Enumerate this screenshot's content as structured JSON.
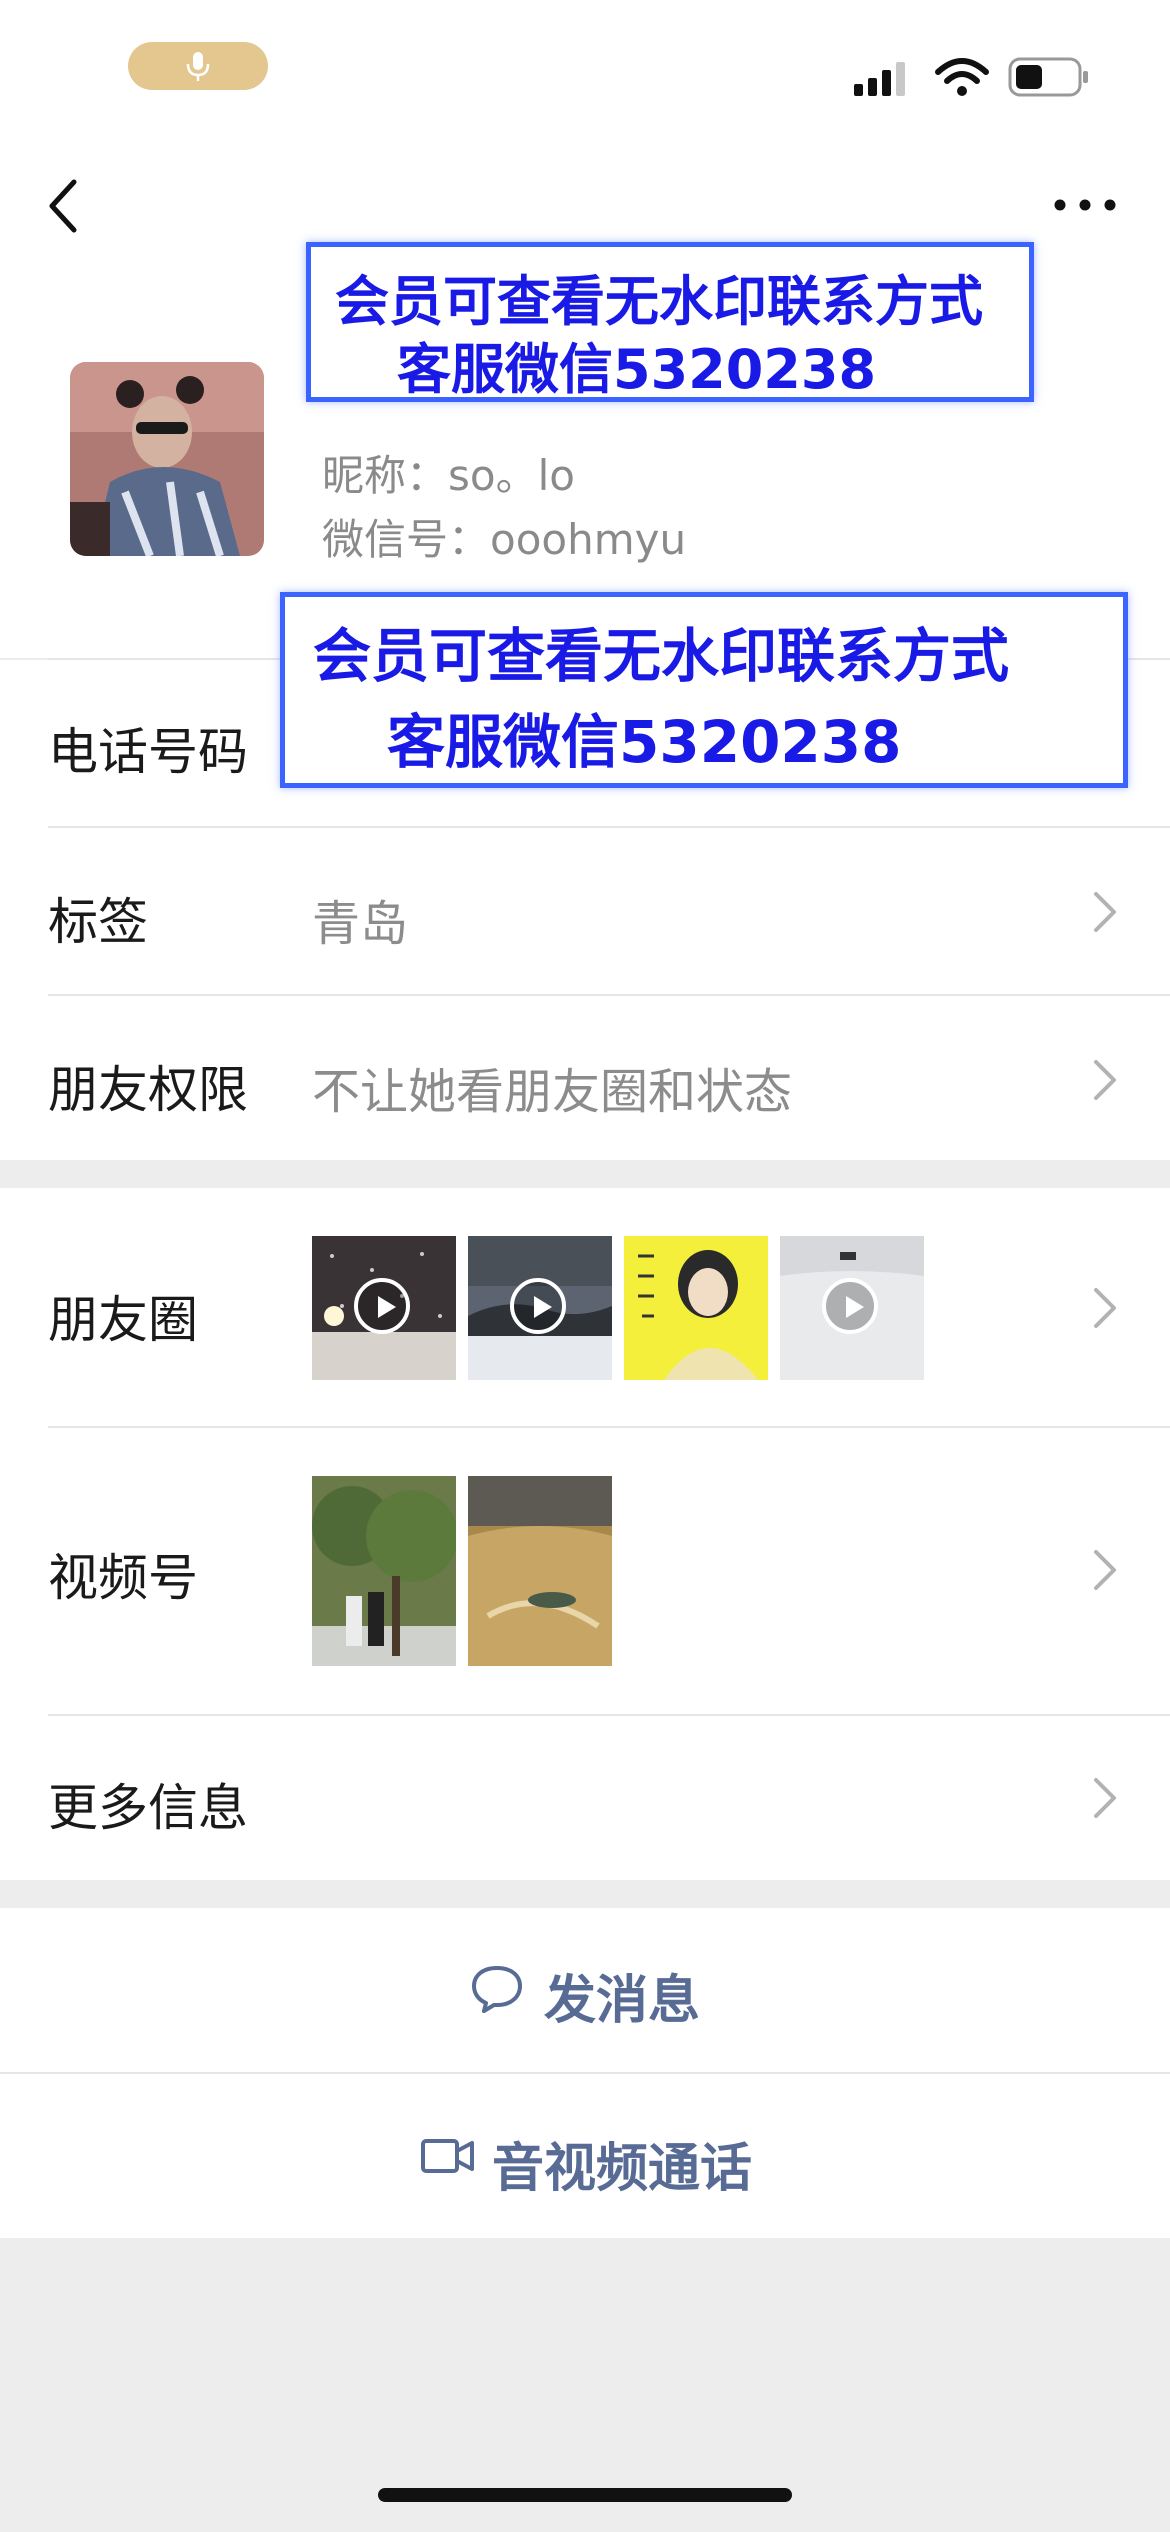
{
  "status_bar": {
    "mic_icon": "microphone-icon",
    "signal_icon": "cellular-signal-icon",
    "wifi_icon": "wifi-icon",
    "battery_icon": "battery-icon"
  },
  "nav": {
    "back_icon": "chevron-left-icon",
    "more_icon": "more-dots-icon"
  },
  "profile": {
    "nickname": "昵称：so。lo",
    "wechat_id": "微信号：ooohmyu"
  },
  "watermark": {
    "line1": "会员可查看无水印联系方式",
    "line2": "客服微信5320238"
  },
  "rows": {
    "phone": {
      "label": "电话号码"
    },
    "tags": {
      "label": "标签",
      "value": "青岛"
    },
    "permissions": {
      "label": "朋友权限",
      "value": "不让她看朋友圈和状态"
    },
    "moments": {
      "label": "朋友圈"
    },
    "channels": {
      "label": "视频号"
    },
    "more_info": {
      "label": "更多信息"
    }
  },
  "actions": {
    "message": {
      "label": "发消息",
      "icon": "chat-bubble-icon"
    },
    "call": {
      "label": "音视频通话",
      "icon": "video-camera-icon"
    }
  },
  "colors": {
    "link_blue": "#576b95",
    "watermark_blue": "#1a1ae6",
    "background": "#ededed"
  }
}
